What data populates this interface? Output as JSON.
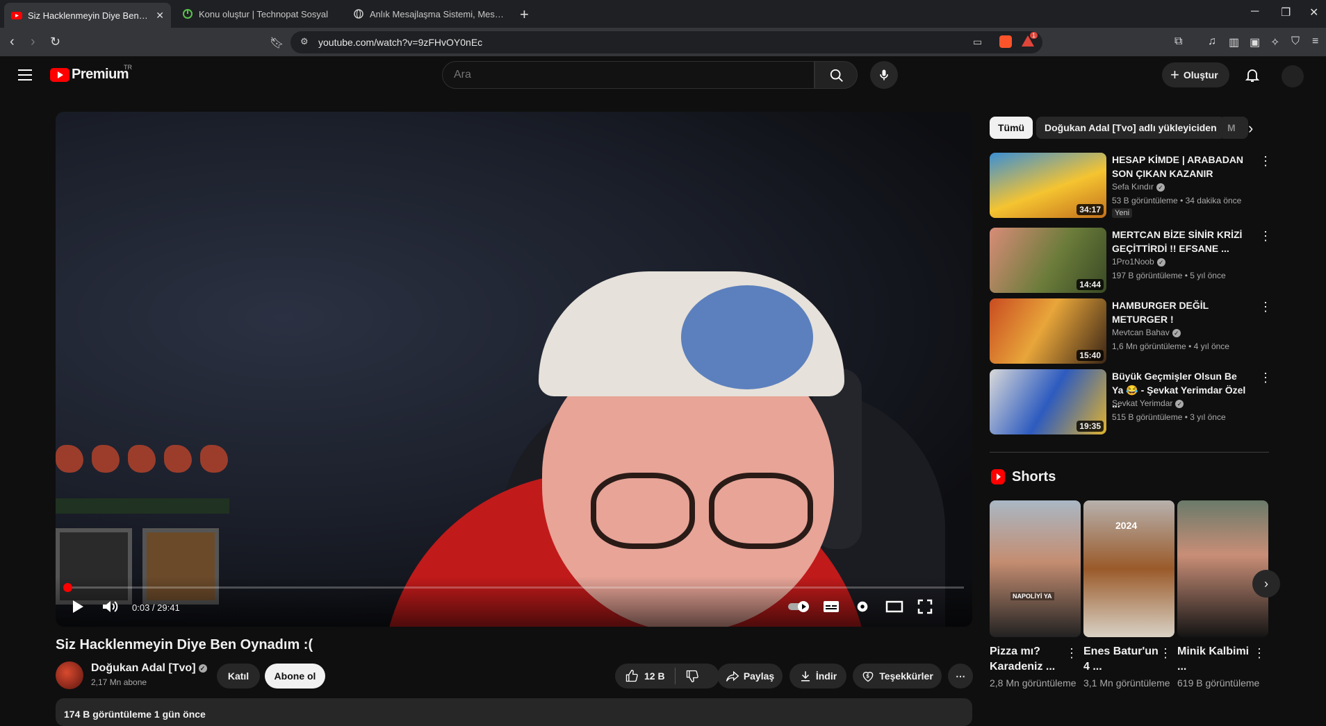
{
  "browser": {
    "tabs": [
      {
        "title": "Siz Hacklenmeyin Diye Ben Oyna",
        "active": true
      },
      {
        "title": "Konu oluştur | Technopat Sosyal",
        "active": false
      },
      {
        "title": "Anlık Mesajlaşma Sistemi, Mesaj Gön",
        "active": false
      }
    ],
    "url": "youtube.com/watch?v=9zFHvOY0nEc",
    "notification_badge": "1"
  },
  "header": {
    "logo_text": "Premium",
    "region": "TR",
    "search_placeholder": "Ara",
    "create_label": "Oluştur"
  },
  "player": {
    "time": "0:03 / 29:41",
    "progress": 0.0017
  },
  "video": {
    "title": "Siz Hacklenmeyin Diye Ben Oynadım :(",
    "channel": "Doğukan Adal [Tvo]",
    "subscribers": "2,17 Mn abone",
    "join_label": "Katıl",
    "subscribe_label": "Abone ol",
    "likes": "12 B",
    "share_label": "Paylaş",
    "download_label": "İndir",
    "thanks_label": "Teşekkürler",
    "views_date": "174 B görüntüleme  1 gün önce"
  },
  "sidebar": {
    "chips": [
      "Tümü",
      "Doğukan Adal [Tvo] adlı yükleyiciden",
      "M"
    ],
    "recommendations": [
      {
        "title": "HESAP KİMDE | ARABADAN SON ÇIKAN KAZANIR",
        "channel": "Sefa Kındır",
        "meta": "53 B görüntüleme • 34 dakika önce",
        "duration": "34:17",
        "badge": "Yeni"
      },
      {
        "title": "MERTCAN BİZE SİNİR KRİZİ GEÇİTTİRDİ !! EFSANE ...",
        "channel": "1Pro1Noob",
        "meta": "197 B görüntüleme • 5 yıl önce",
        "duration": "14:44",
        "badge": ""
      },
      {
        "title": "HAMBURGER DEĞİL METURGER !",
        "channel": "Mevtcan Bahav",
        "meta": "1,6 Mn görüntüleme • 4 yıl önce",
        "duration": "15:40",
        "badge": ""
      },
      {
        "title": "Büyük Geçmişler Olsun Be Ya 😂 - Şevkat Yerimdar Özel ...",
        "channel": "Şevkat Yerimdar",
        "meta": "515 B görüntüleme • 3 yıl önce",
        "duration": "19:35",
        "badge": ""
      }
    ],
    "shorts_title": "Shorts",
    "shorts": [
      {
        "title": "Pizza mı? Karadeniz ...",
        "views": "2,8 Mn görüntüleme",
        "overlay": "NAPOLİYİ YA"
      },
      {
        "title": "Enes Batur'un 4 ...",
        "views": "3,1 Mn görüntüleme",
        "overlay": "2024"
      },
      {
        "title": "Minik Kalbimi ...",
        "views": "619 B görüntüleme",
        "overlay": ""
      }
    ]
  }
}
